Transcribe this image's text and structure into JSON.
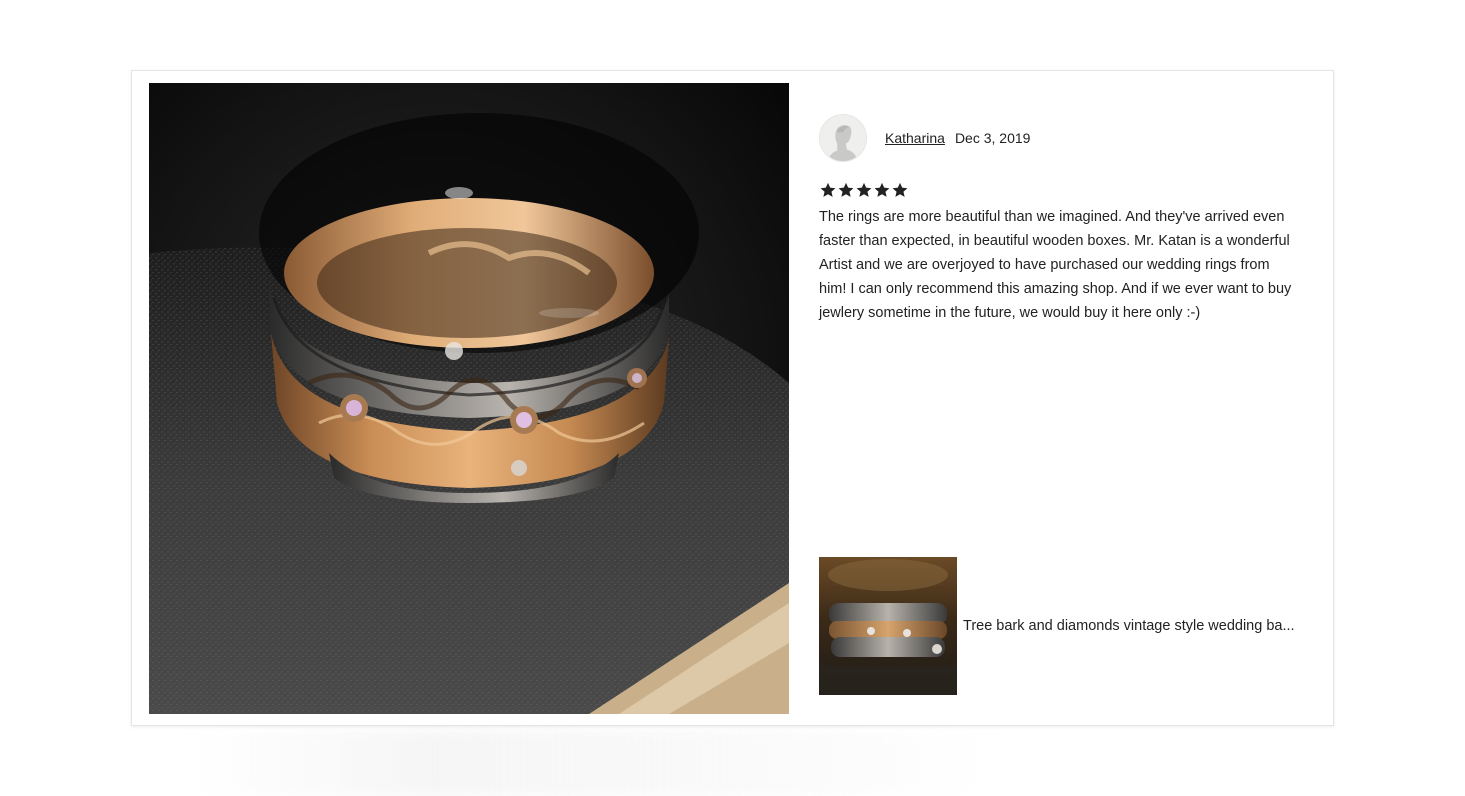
{
  "review": {
    "reviewer_name": "Katharina",
    "date": "Dec 3, 2019",
    "rating": 5,
    "rating_max": 5,
    "text": "The rings are more beautiful than we imagined. And they've arrived even faster than expected, in beautiful wooden boxes. Mr. Katan is a wonderful Artist and we are overjoyed to have purchased our wedding rings from him! I can only recommend this amazing shop. And if we ever want to buy jewlery sometime in the future, we would buy it here only :-)"
  },
  "item": {
    "title": "Tree bark and diamonds vintage style wedding ba..."
  },
  "icons": {
    "avatar": "default-user-avatar-icon",
    "star": "star-filled-icon"
  },
  "colors": {
    "text": "#222222",
    "star": "#222222",
    "modal_border": "#e4e4e4",
    "gold": "#c9955e",
    "oxidized_silver": "#3a3a3a"
  }
}
